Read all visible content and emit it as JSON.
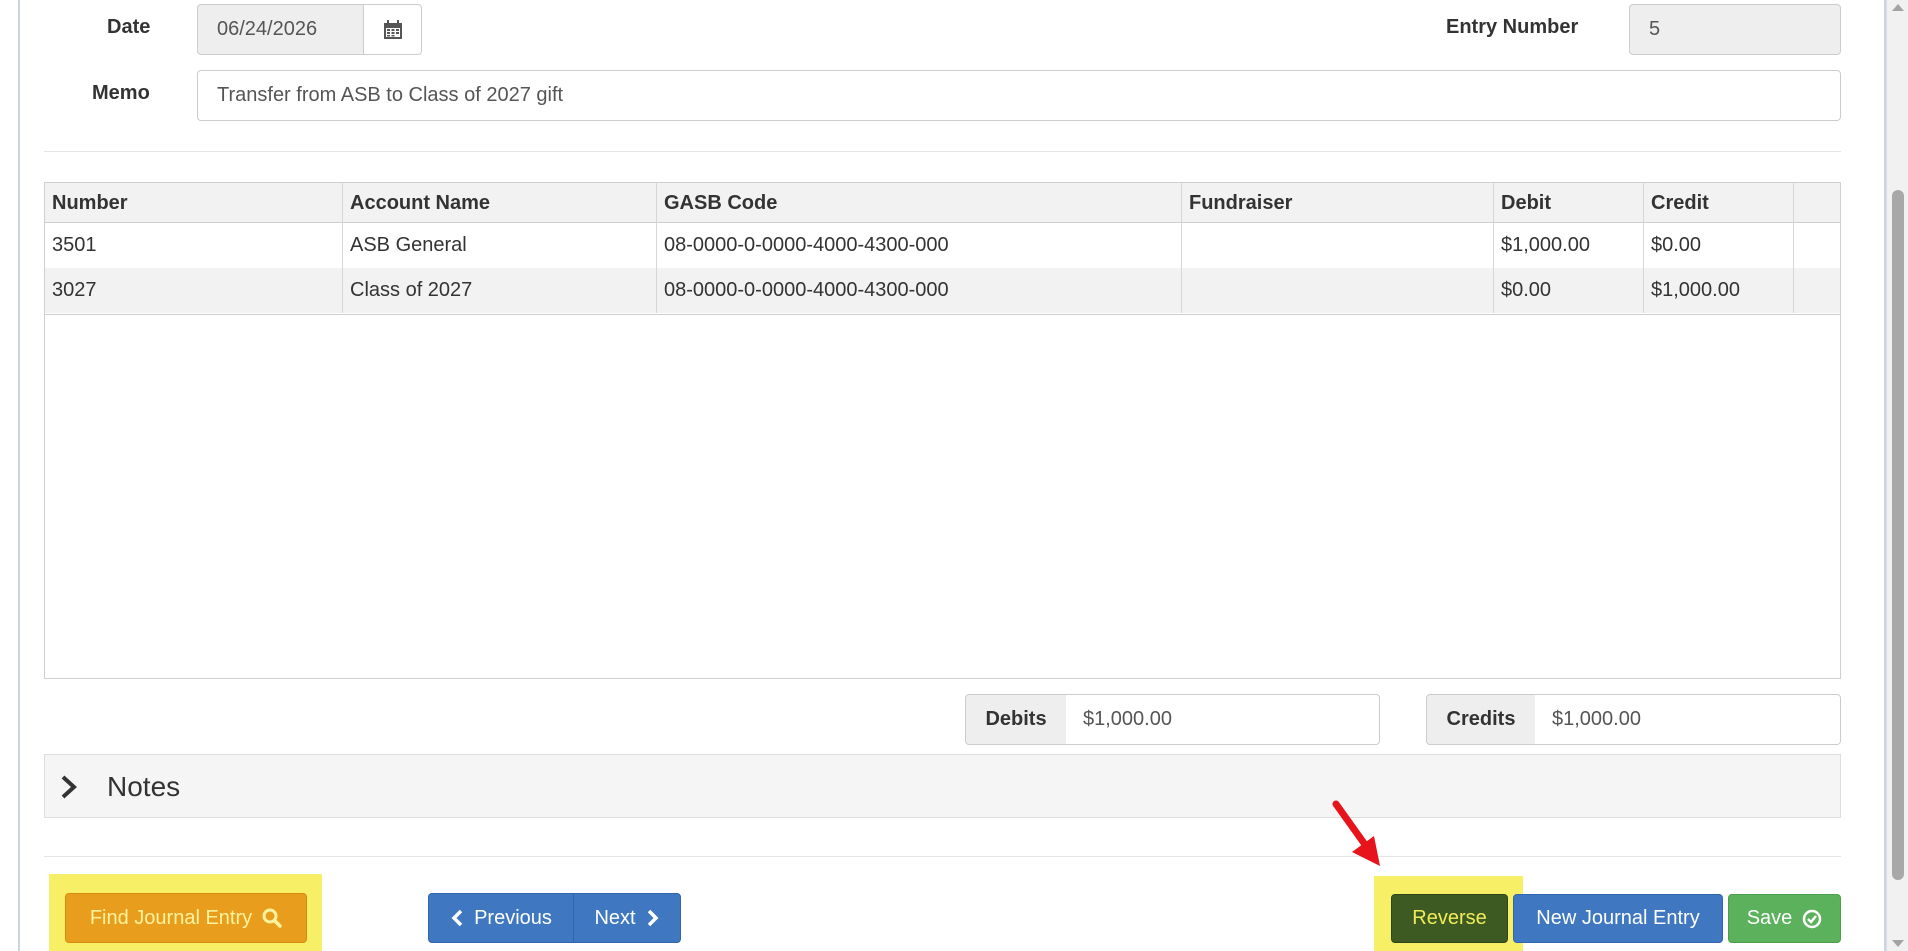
{
  "form": {
    "date_label": "Date",
    "date_value": "06/24/2026",
    "entry_number_label": "Entry Number",
    "entry_number_value": "5",
    "memo_label": "Memo",
    "memo_value": "Transfer from ASB to Class of 2027 gift"
  },
  "grid": {
    "columns": [
      "Number",
      "Account Name",
      "GASB Code",
      "Fundraiser",
      "Debit",
      "Credit"
    ],
    "rows": [
      {
        "number": "3501",
        "account_name": "ASB General",
        "gasb_code": "08-0000-0-0000-4000-4300-000",
        "fundraiser": "",
        "debit": "$1,000.00",
        "credit": "$0.00"
      },
      {
        "number": "3027",
        "account_name": "Class of 2027",
        "gasb_code": "08-0000-0-0000-4000-4300-000",
        "fundraiser": "",
        "debit": "$0.00",
        "credit": "$1,000.00"
      }
    ]
  },
  "totals": {
    "debits_label": "Debits",
    "debits_value": "$1,000.00",
    "credits_label": "Credits",
    "credits_value": "$1,000.00"
  },
  "notes": {
    "title": "Notes"
  },
  "buttons": {
    "find_journal_entry": "Find Journal Entry",
    "previous": "Previous",
    "next": "Next",
    "reverse": "Reverse",
    "new_journal_entry": "New Journal Entry",
    "save": "Save"
  },
  "icons": {
    "date_picker": "calendar-icon",
    "notes_toggle": "chevron-right-icon",
    "find": "search-icon",
    "previous": "chevron-left-icon",
    "next": "chevron-right-icon",
    "save": "check-circle-icon",
    "annotation": "red-arrow-icon"
  },
  "colors": {
    "highlight": "#f6ec4a",
    "warning": "#e89e1c",
    "primary": "#3f78c0",
    "reverse": "#3d5a23",
    "success": "#5cb15c",
    "arrow": "#e8141c"
  }
}
